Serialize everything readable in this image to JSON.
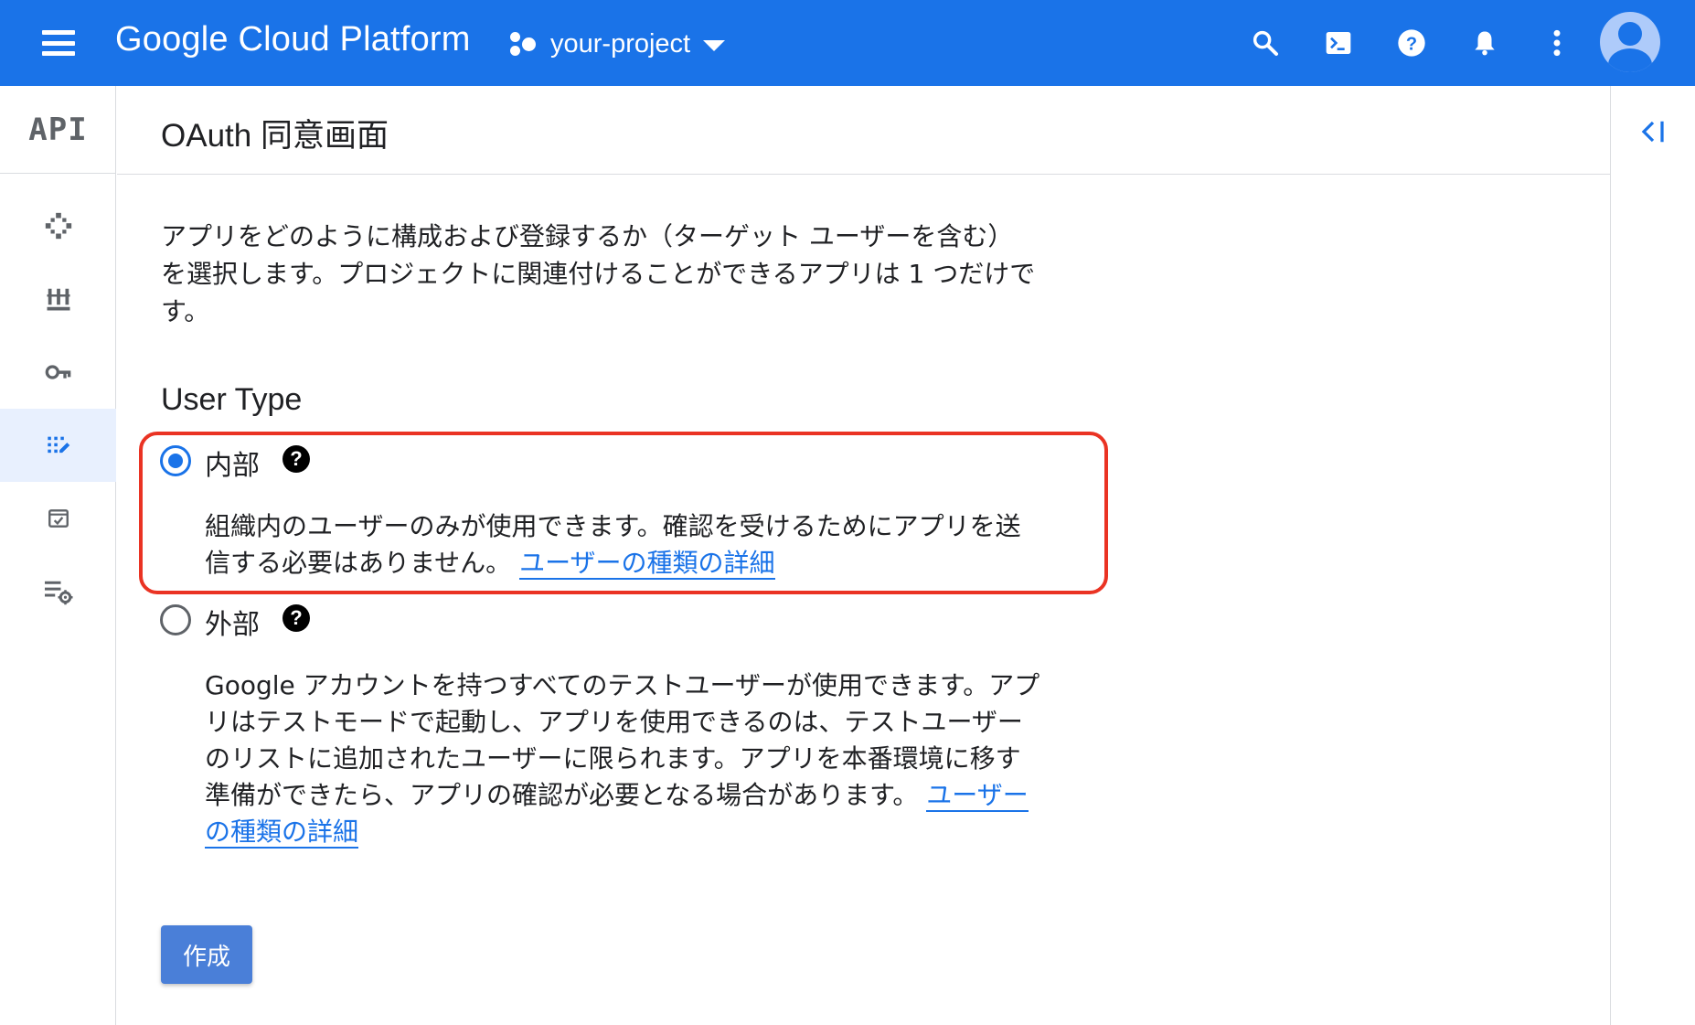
{
  "topbar": {
    "brand": "Google Cloud Platform",
    "project_name": "your-project",
    "icons": [
      "menu-icon",
      "project-icon",
      "search-icon",
      "cloud-shell-icon",
      "help-icon",
      "notifications-icon",
      "more-vert-icon",
      "account-avatar"
    ]
  },
  "leftnav": {
    "logo_text": "API",
    "items": [
      {
        "name": "dashboard-icon",
        "active": false
      },
      {
        "name": "library-icon",
        "active": false
      },
      {
        "name": "credentials-key-icon",
        "active": false
      },
      {
        "name": "oauth-consent-icon",
        "active": true
      },
      {
        "name": "domain-verification-icon",
        "active": false
      },
      {
        "name": "page-settings-icon",
        "active": false
      }
    ]
  },
  "header": {
    "title": "OAuth 同意画面"
  },
  "main": {
    "intro_lines": [
      "アプリをどのように構成および登録するか（ターゲット ユーザーを含む）",
      "を選択します。プロジェクトに関連付けることができるアプリは 1 つだけで",
      "す。"
    ],
    "user_type_title": "User Type",
    "options": [
      {
        "label": "内部",
        "checked": true,
        "desc_lines": [
          "組織内のユーザーのみが使用できます。確認を受けるためにアプリを送",
          "信する必要はありません。"
        ],
        "link_lines": [
          "ユーザーの種類の詳細"
        ]
      },
      {
        "label": "外部",
        "checked": false,
        "desc_lines": [
          "Google アカウントを持つすべてのテストユーザーが使用できます。アプ",
          "リはテストモードで起動し、アプリを使用できるのは、テストユーザー",
          "のリストに追加されたユーザーに限られます。アプリを本番環境に移す",
          "準備ができたら、アプリの確認が必要となる場合があります。"
        ],
        "link_lines": [
          "ユーザー",
          "の種類の詳細"
        ]
      }
    ],
    "help_glyph": "?",
    "create_button": "作成"
  },
  "colors": {
    "topbar": "#1a73e8",
    "highlight_border": "#ea3323",
    "link": "#1a73e8",
    "create_button": "#4a7fd8"
  }
}
